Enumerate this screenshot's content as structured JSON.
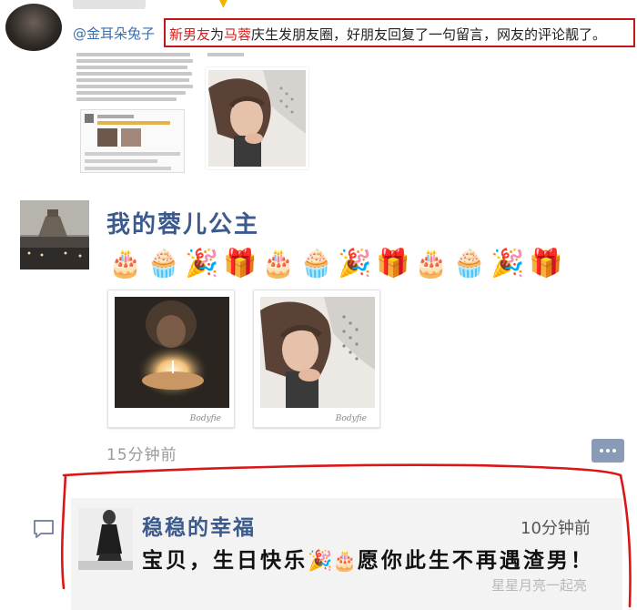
{
  "weibo": {
    "handle": "@金耳朵兔子",
    "headline_red_1": "新男友",
    "headline_mid_1": "为",
    "headline_red_2": "马蓉",
    "headline_rest": "庆生发朋友圈，好朋友回复了一句留言，网友的评论靓了。"
  },
  "moments": {
    "author": "我的蓉儿公主",
    "emojis": [
      "🎂",
      "🧁",
      "🎉",
      "🎁",
      "🎂",
      "🧁",
      "🎉",
      "🎁",
      "🎂",
      "🧁",
      "🎉",
      "🎁"
    ],
    "photo_signature": "Bodyfie",
    "time": "15分钟前"
  },
  "comment": {
    "name": "稳稳的幸福",
    "time": "10分钟前",
    "text_before": "宝贝，生日快乐",
    "emoji_1": "🎉",
    "emoji_2": "🎂",
    "text_after": "愿你此生不再遇渣男！"
  },
  "watermark": "星星月亮一起亮",
  "colors": {
    "name_blue": "#3c5a8c",
    "highlight_red": "#d02020",
    "time_gray": "#999999",
    "comment_bg": "#f3f3f3"
  },
  "icons": [
    "comment-icon",
    "more-dots-icon",
    "chevron-down-icon"
  ]
}
